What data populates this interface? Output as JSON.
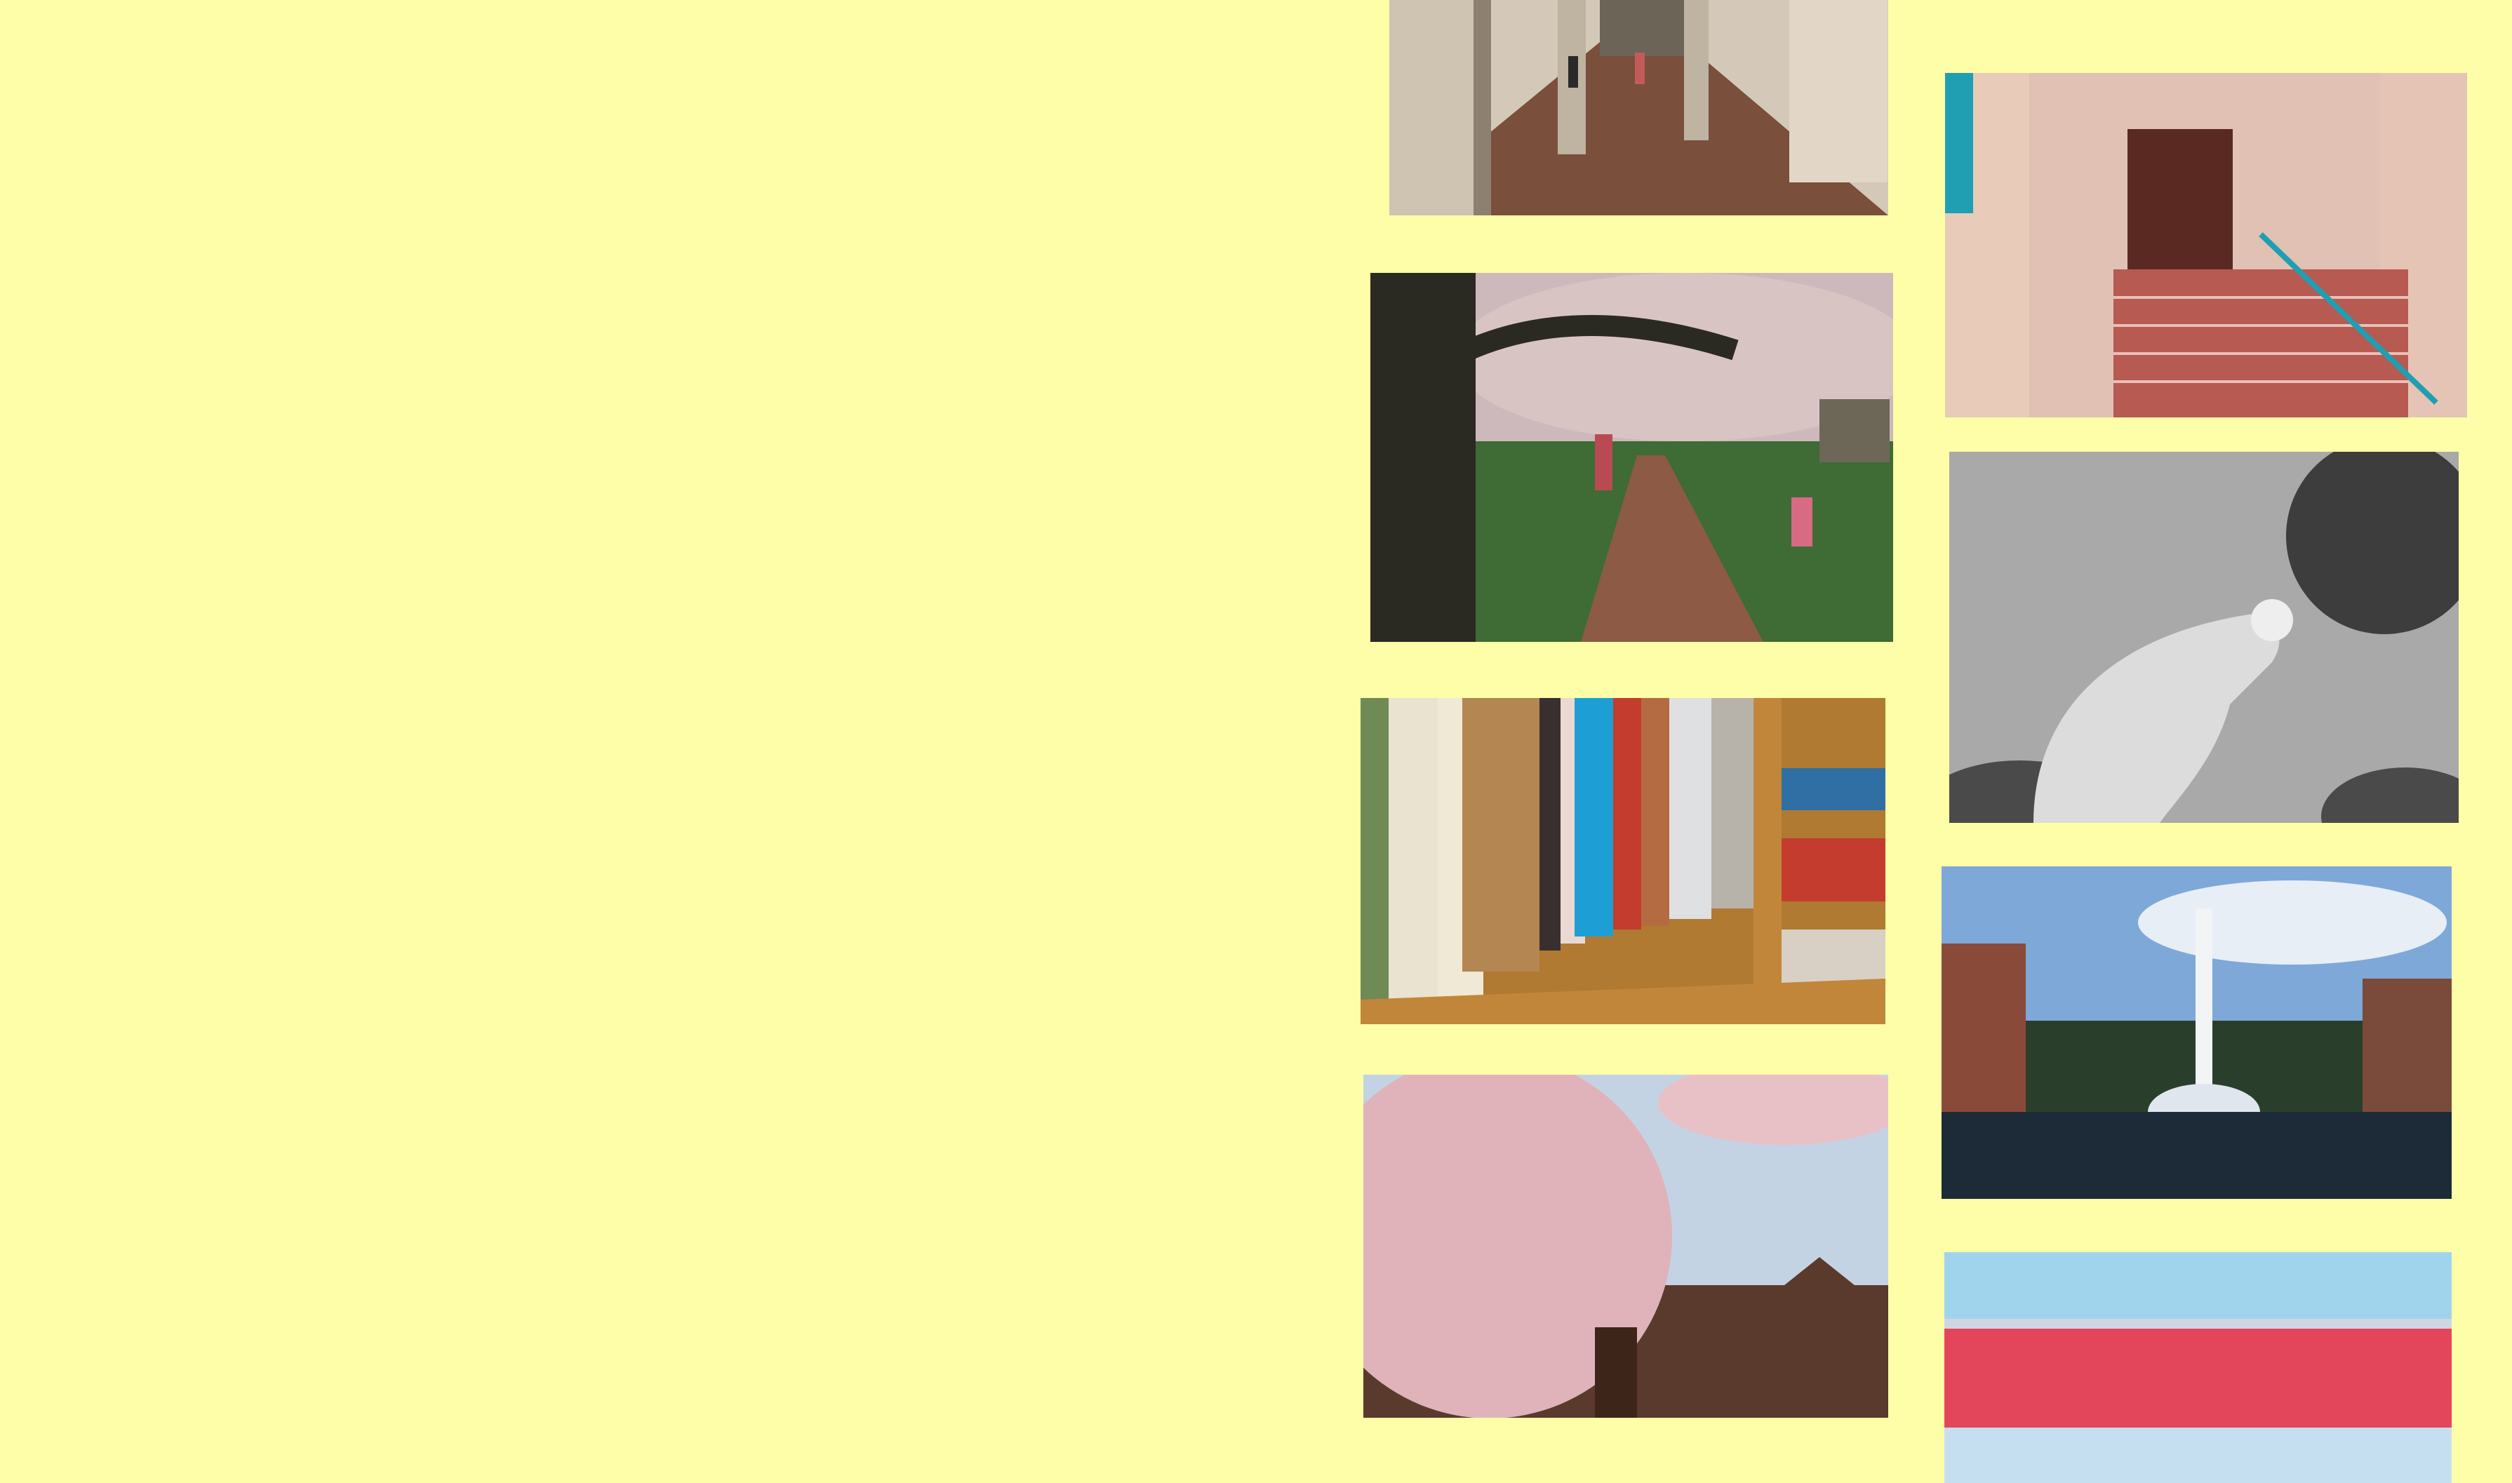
{
  "page": {
    "background": "#FEFEA8"
  },
  "photos": [
    {
      "id": "colonnade",
      "subject": "covered-walkway-with-columns",
      "colors": {
        "floor": "#7a4f3c",
        "columns": "#cfc3b2",
        "shadow": "#8d8070"
      }
    },
    {
      "id": "entrance-stairs",
      "subject": "brick-stairs-to-arched-doorway",
      "colors": {
        "stone": "#e0c1b4",
        "steps": "#b65a52",
        "rail": "#1f9fb1"
      }
    },
    {
      "id": "cherry-blossom-path",
      "subject": "park-path-under-blossoming-trees",
      "colors": {
        "trunk": "#2a2a22",
        "grass": "#3f6b35",
        "path": "#8c5a45",
        "blossom": "#d9c4c4"
      }
    },
    {
      "id": "hand-with-blossom",
      "subject": "black-and-white-hand-holding-flower",
      "colors": {
        "sky": "#a9a9a9",
        "hand": "#dcdcdc",
        "foliage": "#4a4a4a"
      }
    },
    {
      "id": "bookshelf",
      "subject": "library-shelf-of-books",
      "colors": {
        "wood": "#c2863a",
        "spine1": "#e9e3cf",
        "spine2": "#b48651",
        "spine3": "#1d9fd6",
        "spine4": "#c33c2d"
      }
    },
    {
      "id": "fountain",
      "subject": "fountain-in-campus-pond",
      "colors": {
        "sky": "#7ea8d8",
        "water": "#1d2a38",
        "trees": "#2a3e2c",
        "building": "#8a4a3a"
      }
    },
    {
      "id": "blossom-building",
      "subject": "cherry-blossoms-over-gothic-building",
      "colors": {
        "sky": "#c4d3e4",
        "blossom": "#e0b3bb",
        "building": "#5a3a2c"
      }
    },
    {
      "id": "vending-machine",
      "subject": "vending-machine-bottles",
      "colors": {
        "frame": "#8aa0c8",
        "bottles-top": "#9fd4ec",
        "bottles-bottom": "#e3465b"
      }
    }
  ]
}
